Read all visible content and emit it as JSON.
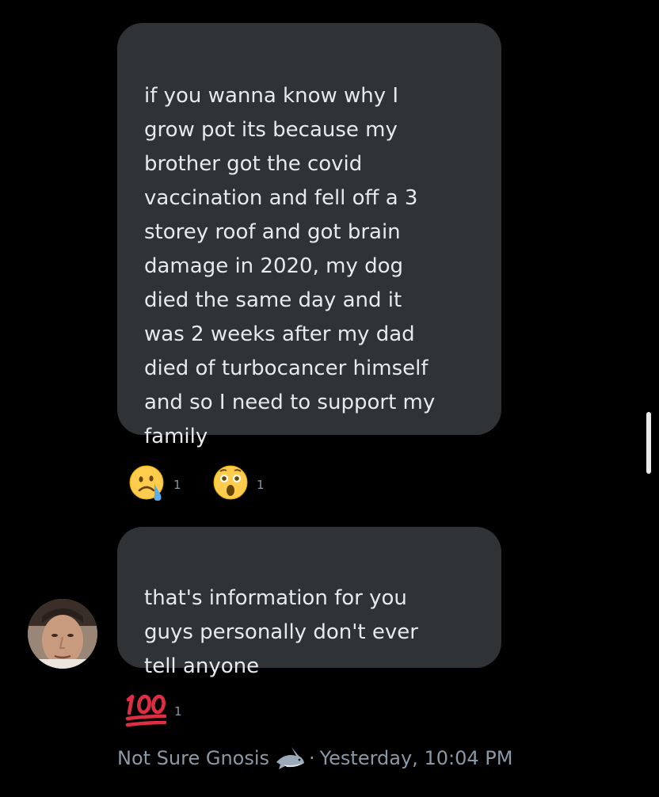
{
  "messages": [
    {
      "text": "if you wanna know why I\ngrow pot its because my\nbrother got the covid\nvaccination and fell off a 3\nstorey roof and got brain\ndamage in 2020, my dog\ndied the same day and it\nwas 2 weeks after my dad\ndied of turbocancer himself\nand so I need to support my\nfamily",
      "reactions": [
        {
          "icon": "crying-face-emoji",
          "count": "1"
        },
        {
          "icon": "surprised-face-emoji",
          "count": "1"
        }
      ]
    },
    {
      "text": "that's information for you\nguys personally don't ever\ntell anyone",
      "reactions": [
        {
          "icon": "hundred-points-emoji",
          "count": "1"
        }
      ]
    }
  ],
  "sender": {
    "name": "Not Sure Gnosis",
    "name_icon": "shark-emoji",
    "separator": "·",
    "timestamp": "Yesterday, 10:04 PM"
  },
  "colors": {
    "background": "#000000",
    "bubble": "#2f3336",
    "text": "#e7e9ea",
    "secondary_text": "#8b98a5"
  }
}
